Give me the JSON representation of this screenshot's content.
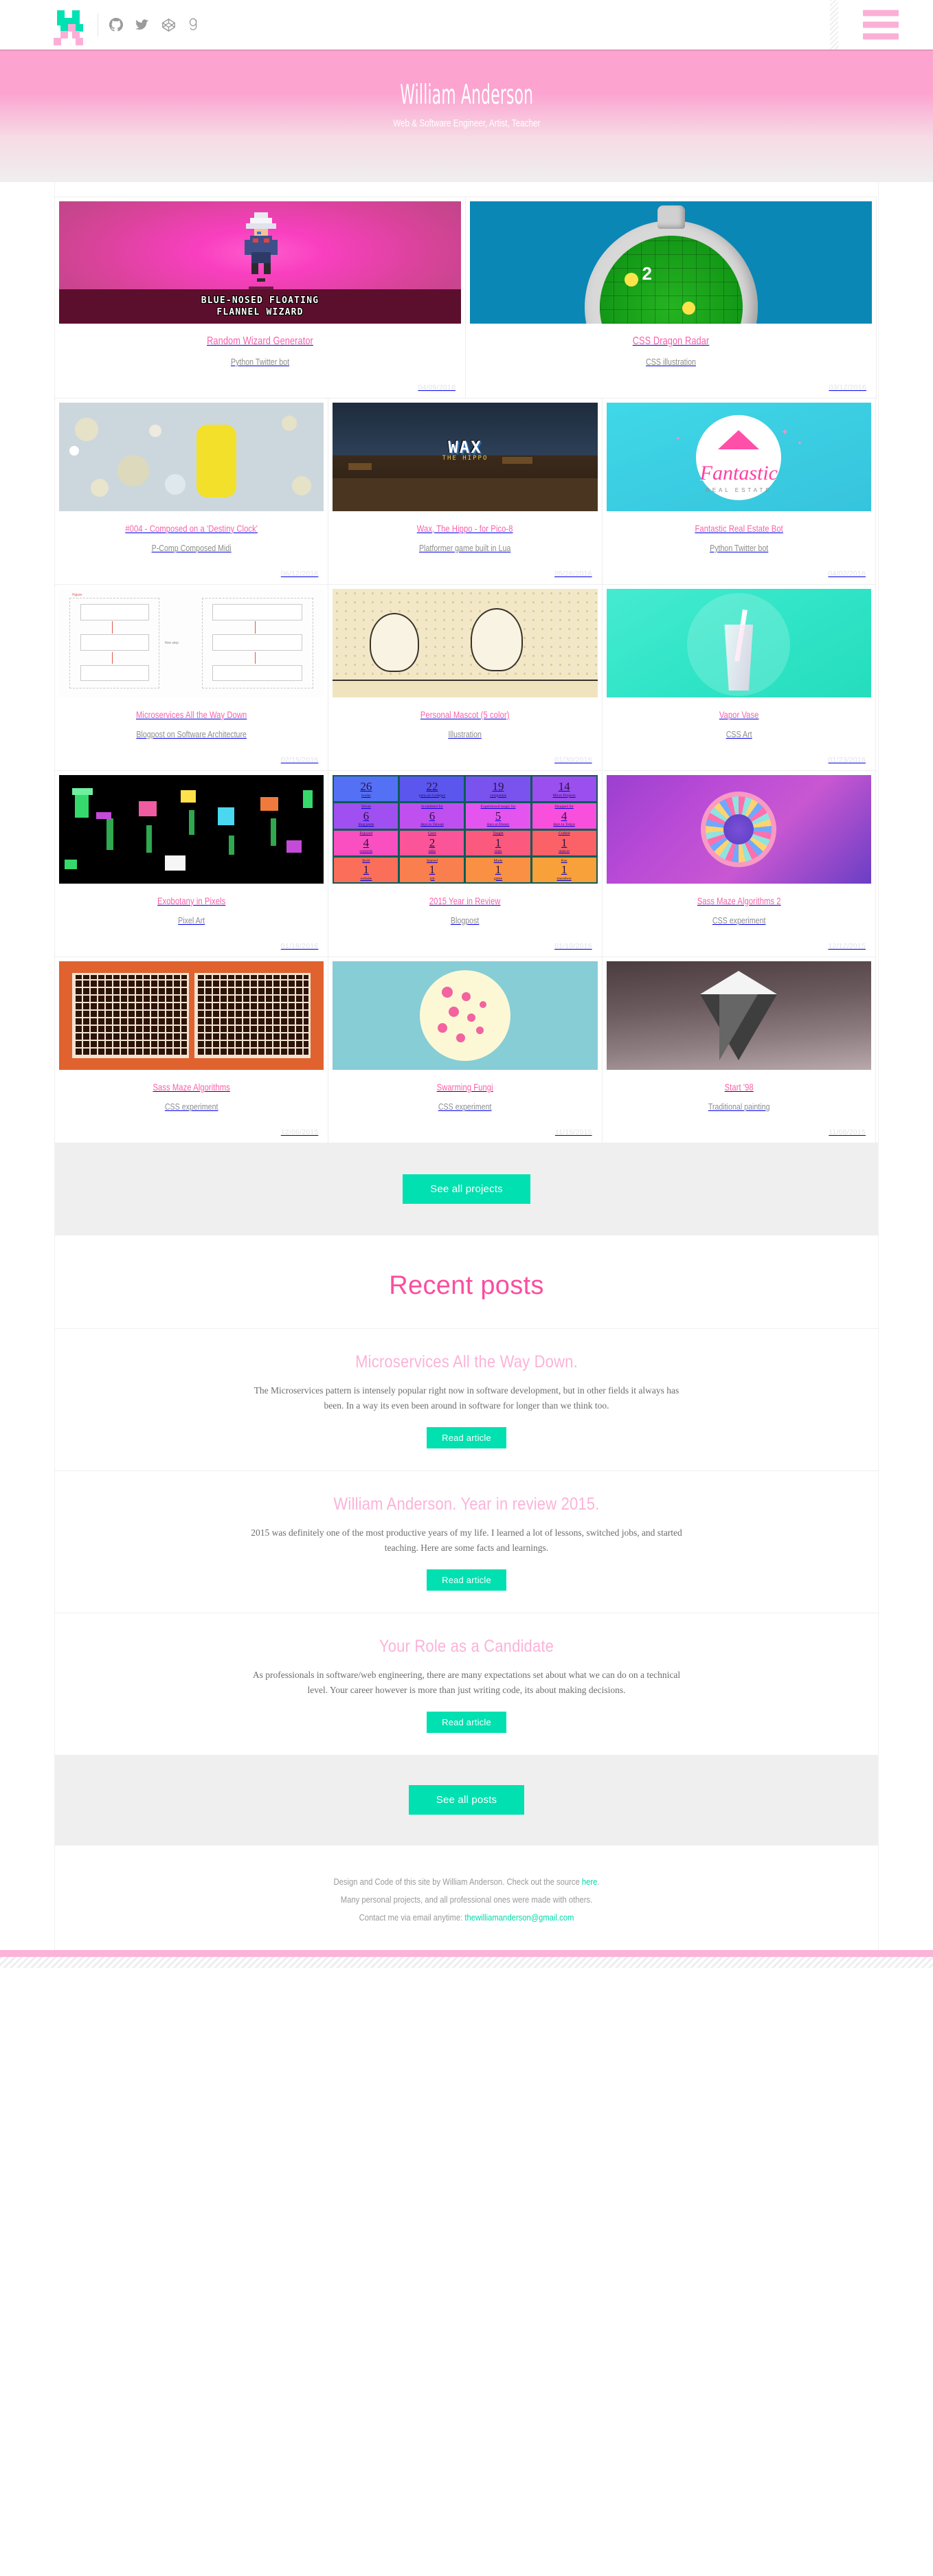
{
  "nav": {
    "logo_name": "pixel-logo",
    "social": [
      {
        "name": "github",
        "glyph": "github-icon"
      },
      {
        "name": "twitter",
        "glyph": "twitter-icon"
      },
      {
        "name": "codepen",
        "glyph": "codepen-icon"
      },
      {
        "name": "goodreads",
        "glyph": "goodreads-icon"
      }
    ],
    "menu_label": "menu"
  },
  "hero": {
    "title": "William Anderson",
    "subtitle": "Web & Software Engineer, Artist, Teacher"
  },
  "projects": {
    "rows": [
      {
        "layout": "two",
        "items": [
          {
            "title": "Random Wizard Generator",
            "subtitle": "Python Twitter bot",
            "date": "04/09/2016",
            "art": "wizard",
            "banner_line1": "BLUE-NOSED FLOATING",
            "banner_line2": "FLANNEL WIZARD"
          },
          {
            "title": "CSS Dragon Radar",
            "subtitle": "CSS illustration",
            "date": "03/12/2016",
            "art": "radar",
            "radar_number": "2"
          }
        ]
      },
      {
        "layout": "three",
        "items": [
          {
            "title": "#004 - Composed on a 'Destiny Clock'",
            "subtitle": "P-Comp Composed Midi",
            "date": "06/12/2016",
            "art": "destiny"
          },
          {
            "title": "Wax, The Hippo - for Pico-8",
            "subtitle": "Platformer game built in Lua",
            "date": "05/26/2016",
            "art": "wax",
            "wax_title": "WAX",
            "wax_sub": "THE HIPPO"
          },
          {
            "title": "Fantastic Real Estate Bot",
            "subtitle": "Python Twitter bot",
            "date": "04/02/2016",
            "art": "fre",
            "fre_name": "Fantastic",
            "fre_sub": "REAL ESTATE"
          }
        ]
      },
      {
        "layout": "three",
        "items": [
          {
            "title": "Microservices All the Way Down",
            "subtitle": "Blogpost on Software Architecture",
            "date": "02/15/2016",
            "art": "micro"
          },
          {
            "title": "Personal Mascot (5 color)",
            "subtitle": "Illustration",
            "date": "01/30/2016",
            "art": "mascot"
          },
          {
            "title": "Vapor Vase",
            "subtitle": "CSS Art",
            "date": "01/23/2016",
            "art": "vase"
          }
        ]
      },
      {
        "layout": "three",
        "items": [
          {
            "title": "Exobotany in Pixels",
            "subtitle": "Pixel Art",
            "date": "01/18/2016",
            "art": "exo"
          },
          {
            "title": "2015 Year in Review",
            "subtitle": "Blogpost",
            "date": "01/10/2016",
            "art": "y2015",
            "cells": [
              {
                "big": "26",
                "sm_top": "",
                "sm_bot": "books",
                "bg": "#5470f5"
              },
              {
                "big": "22",
                "sm_top": "",
                "sm_bot": "pens on Codepen",
                "bg": "#5a56ee"
              },
              {
                "big": "19",
                "sm_top": "",
                "sm_bot": "companies",
                "bg": "#7a52ee"
              },
              {
                "big": "14",
                "sm_top": "",
                "sm_bot": "Micro Projects",
                "bg": "#9b4fee"
              },
              {
                "big": "6",
                "sm_top": "Wrote",
                "sm_bot": "blog posts",
                "bg": "#a04ff0"
              },
              {
                "big": "6",
                "sm_top": "Scrambled for",
                "sm_bot": "days in Taiwan",
                "bg": "#c04ff0"
              },
              {
                "big": "5",
                "sm_top": "Experienced magic for",
                "sm_bot": "days at Disney",
                "bg": "#e455f0"
              },
              {
                "big": "4",
                "sm_top": "Shopped for",
                "sm_bot": "days in Tokyo",
                "bg": "#f84fdc"
              },
              {
                "big": "4",
                "sm_top": "Enjoyed",
                "sm_bot": "concerts",
                "bg": "#fa4fc0"
              },
              {
                "big": "2",
                "sm_top": "Gave",
                "sm_bot": "talks",
                "bg": "#fb5499"
              },
              {
                "big": "1",
                "sm_top": "Taught",
                "sm_bot": "class",
                "bg": "#fb5a7e"
              },
              {
                "big": "1",
                "sm_top": "Crafted",
                "sm_bot": "mascot",
                "bg": "#fb6268"
              },
              {
                "big": "1",
                "sm_top": "Built",
                "sm_bot": "website",
                "bg": "#fb6f5a"
              },
              {
                "big": "1",
                "sm_top": "Started",
                "sm_bot": "job",
                "bg": "#fa7f4e"
              },
              {
                "big": "1",
                "sm_top": "Made",
                "sm_bot": "game",
                "bg": "#f99043"
              },
              {
                "big": "1",
                "sm_top": "Ran",
                "sm_bot": "marathon",
                "bg": "#f8a03a"
              }
            ]
          },
          {
            "title": "Sass Maze Algorithms 2",
            "subtitle": "CSS experiment",
            "date": "12/12/2015",
            "art": "sass2"
          }
        ]
      },
      {
        "layout": "three",
        "items": [
          {
            "title": "Sass Maze Algorithms",
            "subtitle": "CSS experiment",
            "date": "12/06/2015",
            "art": "maze"
          },
          {
            "title": "Swarming Fungi",
            "subtitle": "CSS experiment",
            "date": "11/15/2015",
            "art": "fungi"
          },
          {
            "title": "Start '98",
            "subtitle": "Traditional painting",
            "date": "11/08/2015",
            "art": "start98"
          }
        ]
      }
    ],
    "see_all_label": "See all projects"
  },
  "recent": {
    "heading": "Recent posts",
    "read_label": "Read article",
    "see_all_label": "See all posts",
    "posts": [
      {
        "title": "Microservices All the Way Down.",
        "excerpt": "The Microservices pattern is intensely popular right now in software development, but in other fields it always has been. In a way its even been around in software for longer than we think too."
      },
      {
        "title": "William Anderson. Year in review 2015.",
        "excerpt": "2015 was definitely one of the most productive years of my life. I learned a lot of lessons, switched jobs, and started teaching. Here are some facts and learnings."
      },
      {
        "title": "Your Role as a Candidate",
        "excerpt": "As professionals in software/web engineering, there are many expectations set about what we can do on a technical level. Your career however is more than just writing code, its about making decisions."
      }
    ]
  },
  "footer": {
    "line1_pre": "Design and Code of this site by William Anderson. Check out the source ",
    "line1_link": "here",
    "line1_post": ".",
    "line2": "Many personal projects, and all professional ones were made with others.",
    "line3_pre": "Contact me via email anytime: ",
    "line3_link": "thewilliamanderson@gmail.com"
  },
  "colors": {
    "pink": "#fb5fa8",
    "pink_light": "#fcafd6",
    "teal": "#00e0b0",
    "grey_band": "#efefef"
  }
}
